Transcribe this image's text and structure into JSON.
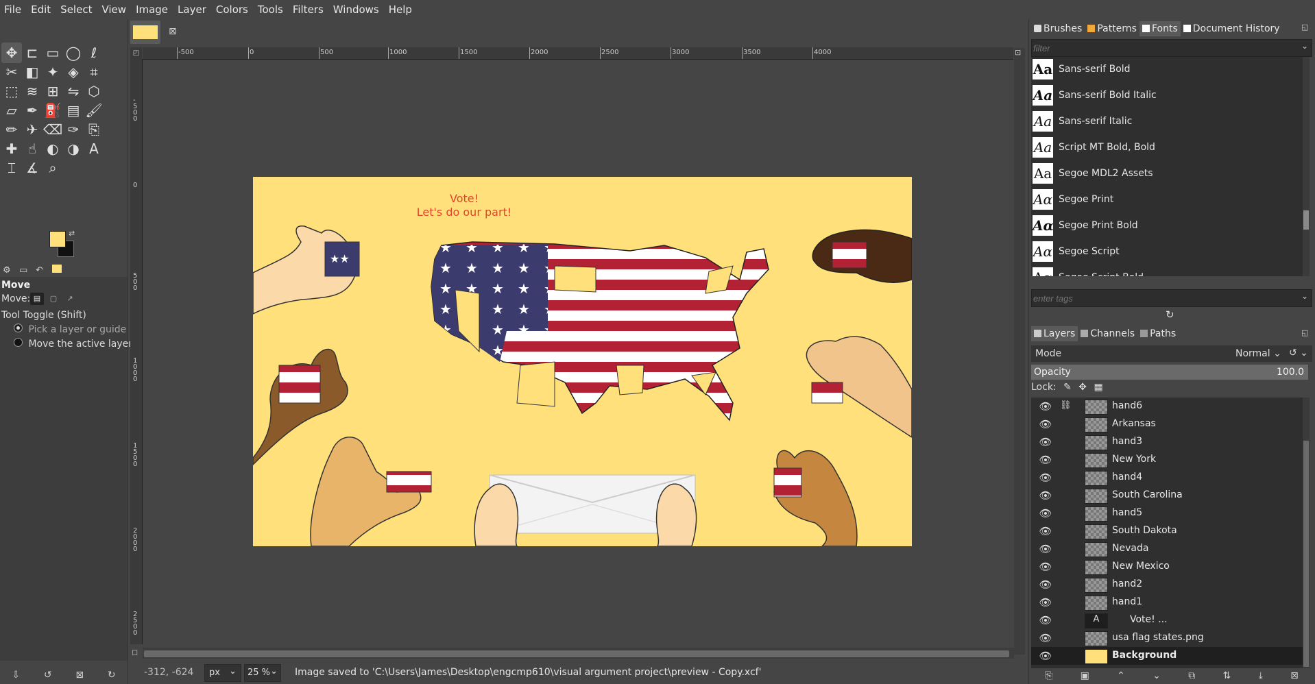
{
  "menubar": {
    "items": [
      "File",
      "Edit",
      "Select",
      "View",
      "Image",
      "Layer",
      "Colors",
      "Tools",
      "Filters",
      "Windows",
      "Help"
    ]
  },
  "toolbox": {
    "tools": [
      "move",
      "align",
      "rect-select",
      "ellipse-select",
      "free-select",
      "scissors",
      "foreground-select",
      "fuzzy-select",
      "select-by-color",
      "crop",
      "unified-transform",
      "warp-transform",
      "handle-transform",
      "flip",
      "cage",
      "perspective",
      "paths",
      "paint-bucket",
      "gradient",
      "paintbrush",
      "pencil",
      "airbrush",
      "eraser",
      "ink",
      "clone",
      "heal",
      "smudge",
      "dodge",
      "burn",
      "text",
      "color-picker",
      "measure",
      "zoom"
    ],
    "fg_color": "#ffe07a",
    "bg_color": "#111111"
  },
  "tool_options": {
    "title": "Move",
    "move_label": "Move:",
    "toggle_label": "Tool Toggle  (Shift)",
    "option_pick": "Pick a layer or guide",
    "option_move": "Move the active layer"
  },
  "rulers": {
    "h_ticks": [
      "-500",
      "0",
      "500",
      "1000",
      "1500",
      "2000",
      "2500",
      "3000",
      "3500",
      "4000"
    ],
    "v_ticks": [
      "-500",
      "0",
      "500",
      "1000",
      "1500",
      "2000",
      "2500"
    ]
  },
  "artwork": {
    "line1": "Vote!",
    "line2": "Let's do our part!"
  },
  "status": {
    "coords": "-312, -624",
    "unit": "px",
    "zoom": "25 %",
    "message": "Image saved to 'C:\\Users\\James\\Desktop\\engcmp610\\visual argument project\\preview - Copy.xcf'"
  },
  "dock_top": {
    "tabs": [
      "Brushes",
      "Patterns",
      "Fonts",
      "Document History"
    ],
    "filter_placeholder": "filter",
    "tags_placeholder": "enter tags",
    "fonts": [
      {
        "icon": "Aa",
        "name": "Sans-serif Bold"
      },
      {
        "icon": "Aa",
        "name": "Sans-serif Bold Italic"
      },
      {
        "icon": "Aa",
        "name": "Sans-serif Italic"
      },
      {
        "icon": "Aa",
        "name": "Script MT Bold, Bold"
      },
      {
        "icon": "Aa",
        "name": "Segoe MDL2 Assets"
      },
      {
        "icon": "Aα",
        "name": "Segoe Print"
      },
      {
        "icon": "Aα",
        "name": "Segoe Print Bold"
      },
      {
        "icon": "Aα",
        "name": "Segoe Script"
      },
      {
        "icon": "Aα",
        "name": "Segoe Script Bold"
      }
    ]
  },
  "dock_bottom": {
    "tabs": [
      "Layers",
      "Channels",
      "Paths"
    ],
    "mode_label": "Mode",
    "mode_value": "Normal",
    "opacity_label": "Opacity",
    "opacity_value": "100.0",
    "lock_label": "Lock:",
    "layers": [
      {
        "name": "hand6",
        "selected": false
      },
      {
        "name": "Arkansas",
        "selected": false
      },
      {
        "name": "hand3",
        "selected": false
      },
      {
        "name": "New York",
        "selected": false
      },
      {
        "name": "hand4",
        "selected": false
      },
      {
        "name": "South Carolina",
        "selected": false
      },
      {
        "name": "hand5",
        "selected": false
      },
      {
        "name": "South Dakota",
        "selected": false
      },
      {
        "name": "Nevada",
        "selected": false
      },
      {
        "name": "New Mexico",
        "selected": false
      },
      {
        "name": "hand2",
        "selected": false
      },
      {
        "name": "hand1",
        "selected": false
      },
      {
        "name": "Vote!  ...",
        "selected": false
      },
      {
        "name": "usa flag states.png",
        "selected": false
      },
      {
        "name": "Background",
        "selected": true
      }
    ]
  },
  "colors": {
    "doc_bg": "#ffe07a",
    "flag_red": "#b22234",
    "flag_blue": "#3c3b6e",
    "vote_text": "#e0442a"
  }
}
